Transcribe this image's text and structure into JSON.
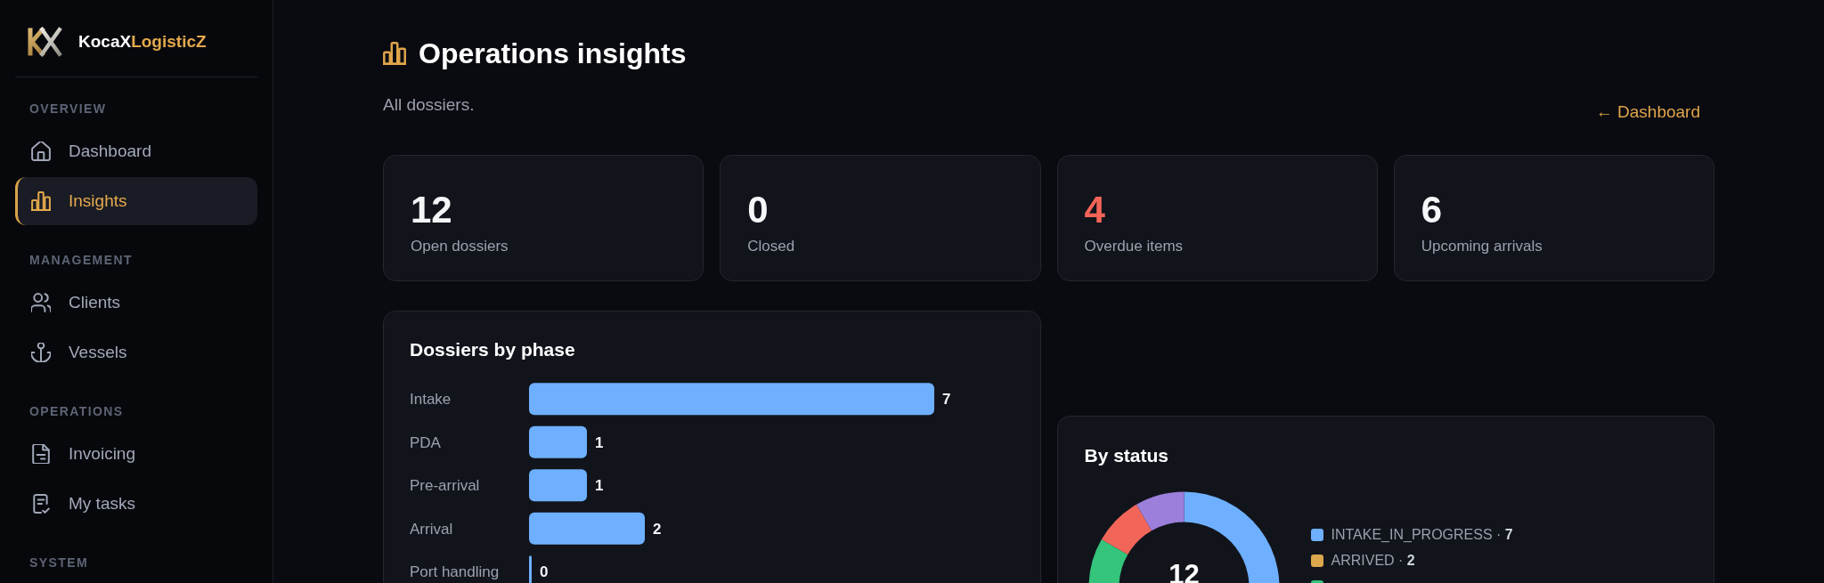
{
  "sidebar": {
    "brand": {
      "name": "KocaX",
      "accent": "LogisticZ"
    },
    "sections": [
      {
        "title": "OVERVIEW",
        "items": [
          {
            "label": "Dashboard",
            "selected": false
          },
          {
            "label": "Insights",
            "selected": true
          }
        ]
      },
      {
        "title": "MANAGEMENT",
        "items": [
          {
            "label": "Clients",
            "selected": false
          },
          {
            "label": "Vessels",
            "selected": false
          }
        ]
      },
      {
        "title": "OPERATIONS",
        "items": [
          {
            "label": "Invoicing",
            "selected": false
          },
          {
            "label": "My tasks",
            "selected": false
          }
        ]
      },
      {
        "title": "SYSTEM"
      }
    ]
  },
  "header": {
    "title": "Operations insights",
    "subtitle": "All dossiers.",
    "back_link": "← Dashboard"
  },
  "stats": [
    {
      "value": "12",
      "label": "Open dossiers",
      "alert": false
    },
    {
      "value": "0",
      "label": "Closed",
      "alert": false
    },
    {
      "value": "4",
      "label": "Overdue items",
      "alert": true
    },
    {
      "value": "6",
      "label": "Upcoming arrivals",
      "alert": false
    }
  ],
  "phase_card": {
    "chart_data": {
      "type": "bar",
      "orientation": "horizontal",
      "title": "Dossiers by phase",
      "categories": [
        "Intake",
        "PDA",
        "Pre-arrival",
        "Arrival",
        "Port handling"
      ],
      "values": [
        7,
        1,
        1,
        2,
        0
      ],
      "data_labels": true
    }
  },
  "status_card": {
    "title": "By status",
    "donut": {
      "total": "12",
      "segments": [
        {
          "color": "#6eb0ff"
        },
        {
          "color": "#35c47c"
        },
        {
          "color": "#f2665a"
        },
        {
          "color": "#9b7fdb"
        }
      ]
    },
    "legend": [
      {
        "text": "INTAKE_IN_PROGRESS · **7**",
        "color": "#6eb0ff"
      },
      {
        "text": "ARRIVED · **2**",
        "color": "#dba84c"
      },
      {
        "color": "#35c47c"
      }
    ]
  }
}
